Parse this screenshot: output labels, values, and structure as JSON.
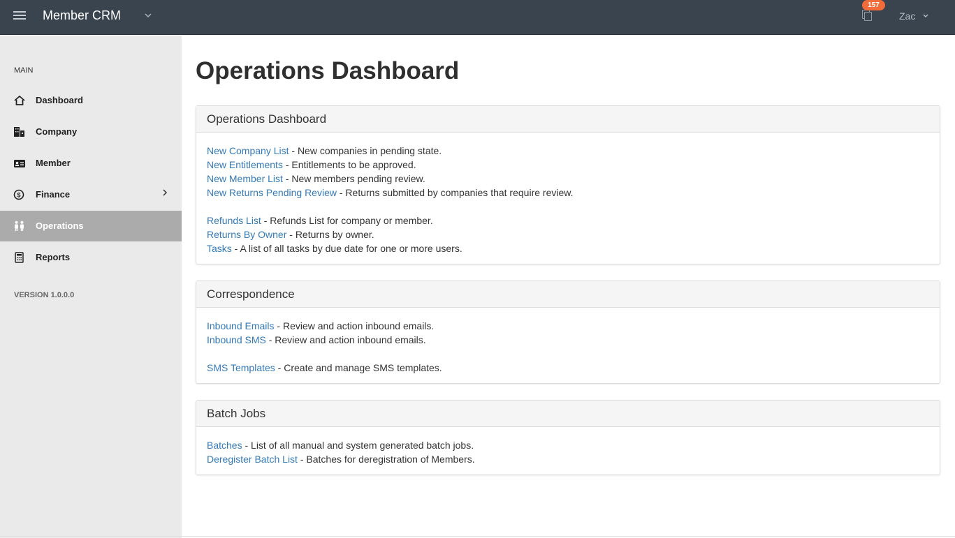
{
  "topbar": {
    "menu_icon": "hamburger-icon",
    "app_title": "Member CRM",
    "app_switch_icon": "chevron-down-icon",
    "notifications_icon": "copy-icon",
    "notification_count": "157",
    "user_name": "Zac",
    "user_chevron": "⌄"
  },
  "sidebar": {
    "section_label": "MAIN",
    "items": [
      {
        "label": "Dashboard",
        "icon": "home-icon",
        "active": false
      },
      {
        "label": "Company",
        "icon": "building-icon",
        "active": false
      },
      {
        "label": "Member",
        "icon": "id-card-icon",
        "active": false
      },
      {
        "label": "Finance",
        "icon": "dollar-circle-icon",
        "active": false,
        "arrow": "›"
      },
      {
        "label": "Operations",
        "icon": "people-icon",
        "active": true
      },
      {
        "label": "Reports",
        "icon": "calculator-icon",
        "active": false
      }
    ],
    "version": "VERSION 1.0.0.0"
  },
  "main": {
    "title": "Operations Dashboard",
    "panels": [
      {
        "title": "Operations Dashboard",
        "groups": [
          [
            {
              "link": "New Company List",
              "desc": " - New companies in pending state."
            },
            {
              "link": "New Entitlements",
              "desc": " - Entitlements to be approved."
            },
            {
              "link": "New Member List",
              "desc": " - New members pending review."
            },
            {
              "link": "New Returns Pending Review",
              "desc": " - Returns submitted by companies that require review."
            }
          ],
          [
            {
              "link": "Refunds List",
              "desc": " - Refunds List for company or member."
            },
            {
              "link": "Returns By Owner",
              "desc": " - Returns by owner."
            },
            {
              "link": "Tasks",
              "desc": " - A list of all tasks by due date for one or more users."
            }
          ]
        ]
      },
      {
        "title": "Correspondence",
        "groups": [
          [
            {
              "link": "Inbound Emails",
              "desc": " - Review and action inbound emails."
            },
            {
              "link": "Inbound SMS",
              "desc": " - Review and action inbound emails."
            }
          ],
          [
            {
              "link": "SMS Templates",
              "desc": " - Create and manage SMS templates."
            }
          ]
        ]
      },
      {
        "title": "Batch Jobs",
        "groups": [
          [
            {
              "link": "Batches",
              "desc": " - List of all manual and system generated batch jobs."
            },
            {
              "link": "Deregister Batch List",
              "desc": " - Batches for deregistration of Members."
            }
          ]
        ]
      }
    ]
  },
  "colors": {
    "topbar": "#39444e",
    "sidebar": "#eaeaea",
    "active_item": "#ababab",
    "link": "#337ab7",
    "badge": "#f26b3a"
  }
}
